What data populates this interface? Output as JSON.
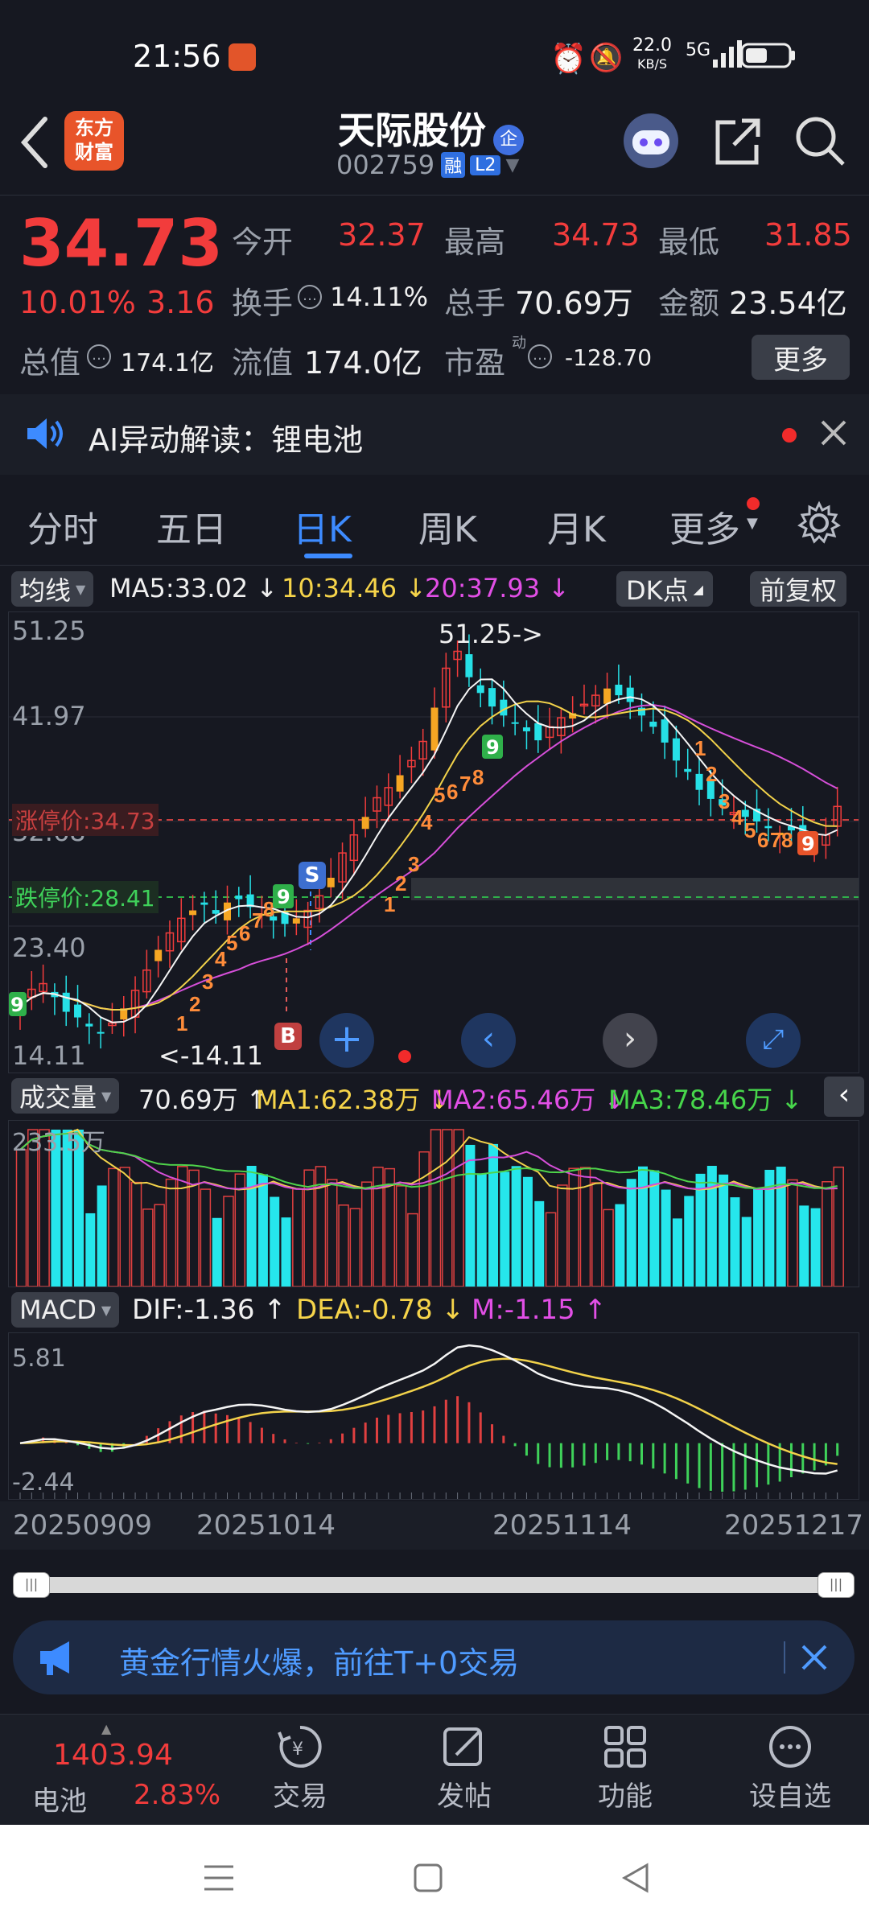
{
  "status_bar": {
    "time": "21:56",
    "net_speed": "22.0",
    "net_unit": "KB/S",
    "network": "5G"
  },
  "header": {
    "app_logo": "东方财富",
    "stock_name": "天际股份",
    "badge_name": "企",
    "code": "002759",
    "tag_margin": "融",
    "tag_level": "L2"
  },
  "quote": {
    "price": "34.73",
    "change_pct": "10.01%",
    "change": "3.16",
    "open_label": "今开",
    "open": "32.37",
    "high_label": "最高",
    "high": "34.73",
    "low_label": "最低",
    "low": "31.85",
    "turnover_label": "换手",
    "turnover": "14.11%",
    "volume_label": "总手",
    "volume": "70.69万",
    "amount_label": "金额",
    "amount": "23.54亿",
    "mcap_label": "总值",
    "mcap": "174.1亿",
    "float_label": "流值",
    "float": "174.0亿",
    "pe_label": "市盈",
    "pe_sup": "动",
    "pe": "-128.70",
    "more": "更多"
  },
  "ai_banner": {
    "label": "AI异动解读：锂电池"
  },
  "tabs": {
    "t1": "分时",
    "t2": "五日",
    "t3": "日K",
    "t4": "周K",
    "t5": "月K",
    "t6": "更多"
  },
  "chart_header": {
    "ma_select": "均线",
    "ma5": "MA5:33.02",
    "ma10": "10:34.46",
    "ma20": "20:37.93",
    "dk": "DK点",
    "adjust": "前复权"
  },
  "kline": {
    "y1": "51.25",
    "y2": "41.97",
    "y3": "32.68",
    "y4": "23.40",
    "y5": "14.11",
    "high_note": "51.25->",
    "low_note": "<-14.11",
    "limit_up": "涨停价:34.73",
    "limit_down": "跌停价:28.41",
    "s_label": "S",
    "b_label": "B"
  },
  "volume": {
    "select": "成交量",
    "value": "70.69万",
    "ma1": "MA1:62.38万",
    "ma2": "MA2:65.46万",
    "ma3": "MA3:78.46万",
    "max": "233.5万"
  },
  "macd": {
    "select": "MACD",
    "dif": "DIF:-1.36",
    "dea": "DEA:-0.78",
    "m": "M:-1.15",
    "top": "5.81",
    "bottom": "-2.44"
  },
  "dates": {
    "d1": "20250909",
    "d2": "20251014",
    "d3": "20251114",
    "d4": "20251217"
  },
  "promo": {
    "text": "黄金行情火爆，前往T+0交易"
  },
  "bottom_nav": {
    "index_value": "1403.94",
    "index_name": "电池",
    "index_pct": "2.83%",
    "trade": "交易",
    "post": "发帖",
    "func": "功能",
    "watch": "设自选"
  },
  "chart_data": {
    "type": "candlestick",
    "x_ticks": [
      "20250909",
      "20251014",
      "20251114",
      "20251217"
    ],
    "price_ticks": [
      51.25,
      41.97,
      32.68,
      23.4,
      14.11
    ],
    "marked_high": 51.25,
    "marked_low": 14.11,
    "limit_up": 34.73,
    "limit_down": 28.41,
    "last_close": 34.73,
    "ma_lines": [
      {
        "name": "MA5",
        "value": 33.02
      },
      {
        "name": "MA10",
        "value": 34.46
      },
      {
        "name": "MA20",
        "value": 37.93
      }
    ],
    "volume_max_label": "233.5万",
    "macd_range": [
      -2.44,
      5.81
    ]
  }
}
